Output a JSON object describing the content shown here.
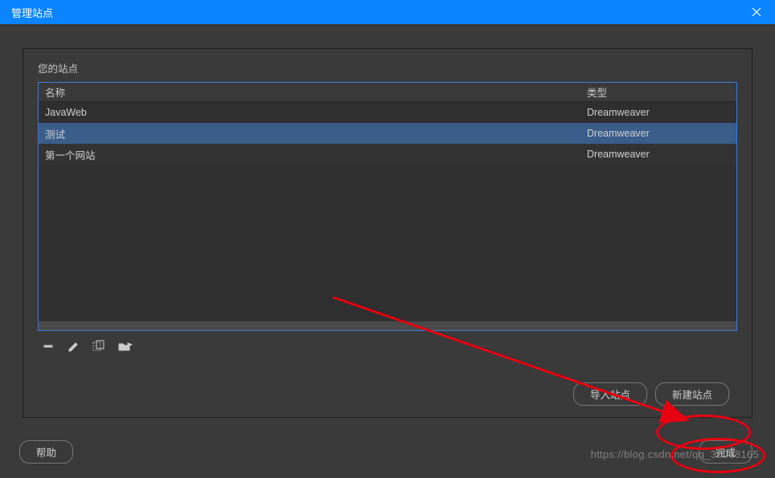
{
  "titlebar": {
    "title": "管理站点"
  },
  "panel": {
    "label": "您的站点",
    "columns": {
      "name": "名称",
      "type": "类型"
    },
    "rows": [
      {
        "name": "JavaWeb",
        "type": "Dreamweaver",
        "selected": false
      },
      {
        "name": "测试",
        "type": "Dreamweaver",
        "selected": true
      },
      {
        "name": "第一个网站",
        "type": "Dreamweaver",
        "selected": false
      }
    ],
    "buttons": {
      "import": "导入站点",
      "new": "新建站点"
    }
  },
  "icons": {
    "remove": "remove-icon",
    "edit": "edit-icon",
    "duplicate": "duplicate-icon",
    "export": "export-icon"
  },
  "footer": {
    "help": "帮助",
    "done": "完成"
  },
  "watermark": "https://blog.csdn.net/qq_30068165",
  "annotation": {
    "color": "#e60012"
  }
}
